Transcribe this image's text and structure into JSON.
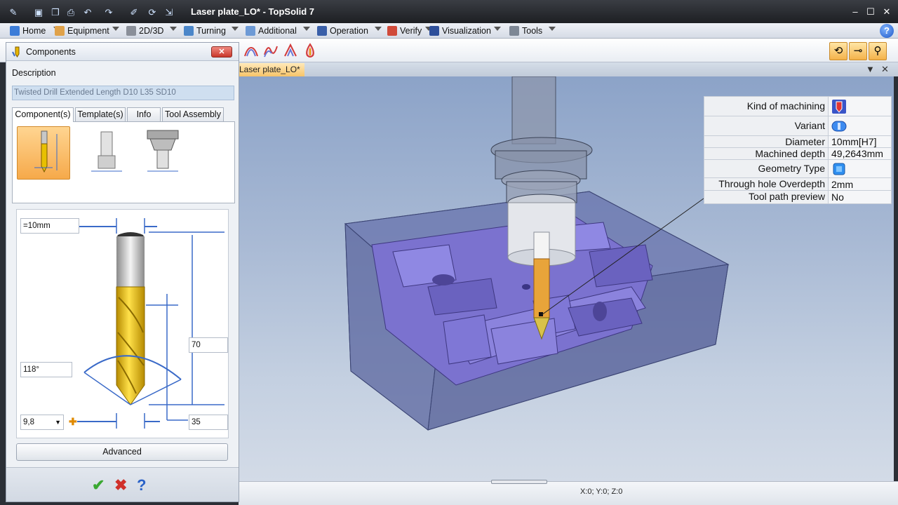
{
  "window": {
    "title": "Laser plate_LO* - TopSolid 7",
    "controls": [
      "–",
      "☐",
      "✕"
    ]
  },
  "menu": {
    "items": [
      "Home",
      "Equipment",
      "2D/3D",
      "Turning",
      "Additional",
      "Operation",
      "Verify",
      "Visualization",
      "Tools"
    ],
    "help": "?"
  },
  "document": {
    "tab": "Laser plate_LO*",
    "status_coords": "X:0; Y:0; Z:0"
  },
  "properties": [
    {
      "label": "Kind of machining",
      "value": "",
      "icon": "drill-tool-icon"
    },
    {
      "label": "Variant",
      "value": "",
      "icon": "variant-icon"
    },
    {
      "label": "Diameter",
      "value": "10mm[H7]"
    },
    {
      "label": "Machined depth",
      "value": "49,2643mm"
    },
    {
      "label": "Geometry Type",
      "value": "",
      "icon": "geometry-type-icon"
    },
    {
      "label": "Through hole Overdepth",
      "value": "2mm"
    },
    {
      "label": "Tool path preview",
      "value": "No"
    }
  ],
  "panel": {
    "title": "Components",
    "description_label": "Description",
    "description_value": "Twisted Drill Extended Length D10 L35 SD10",
    "tabs": [
      "Component(s)",
      "Template(s)",
      "Info",
      "Tool Assembly"
    ],
    "active_tab": "Component(s)",
    "dimensions": {
      "diameter": "=10mm",
      "angle": "118°",
      "flute_diameter": "9,8",
      "length_total": "70",
      "length_cut": "35"
    },
    "advanced_label": "Advanced",
    "footer": {
      "ok": "✔",
      "cancel": "✖",
      "help": "?"
    }
  },
  "colors": {
    "accent_orange": "#f6a94a",
    "part_purple": "#7b72cf",
    "viewport_top": "#8ca3c8",
    "tool_gold": "#e8b700"
  }
}
